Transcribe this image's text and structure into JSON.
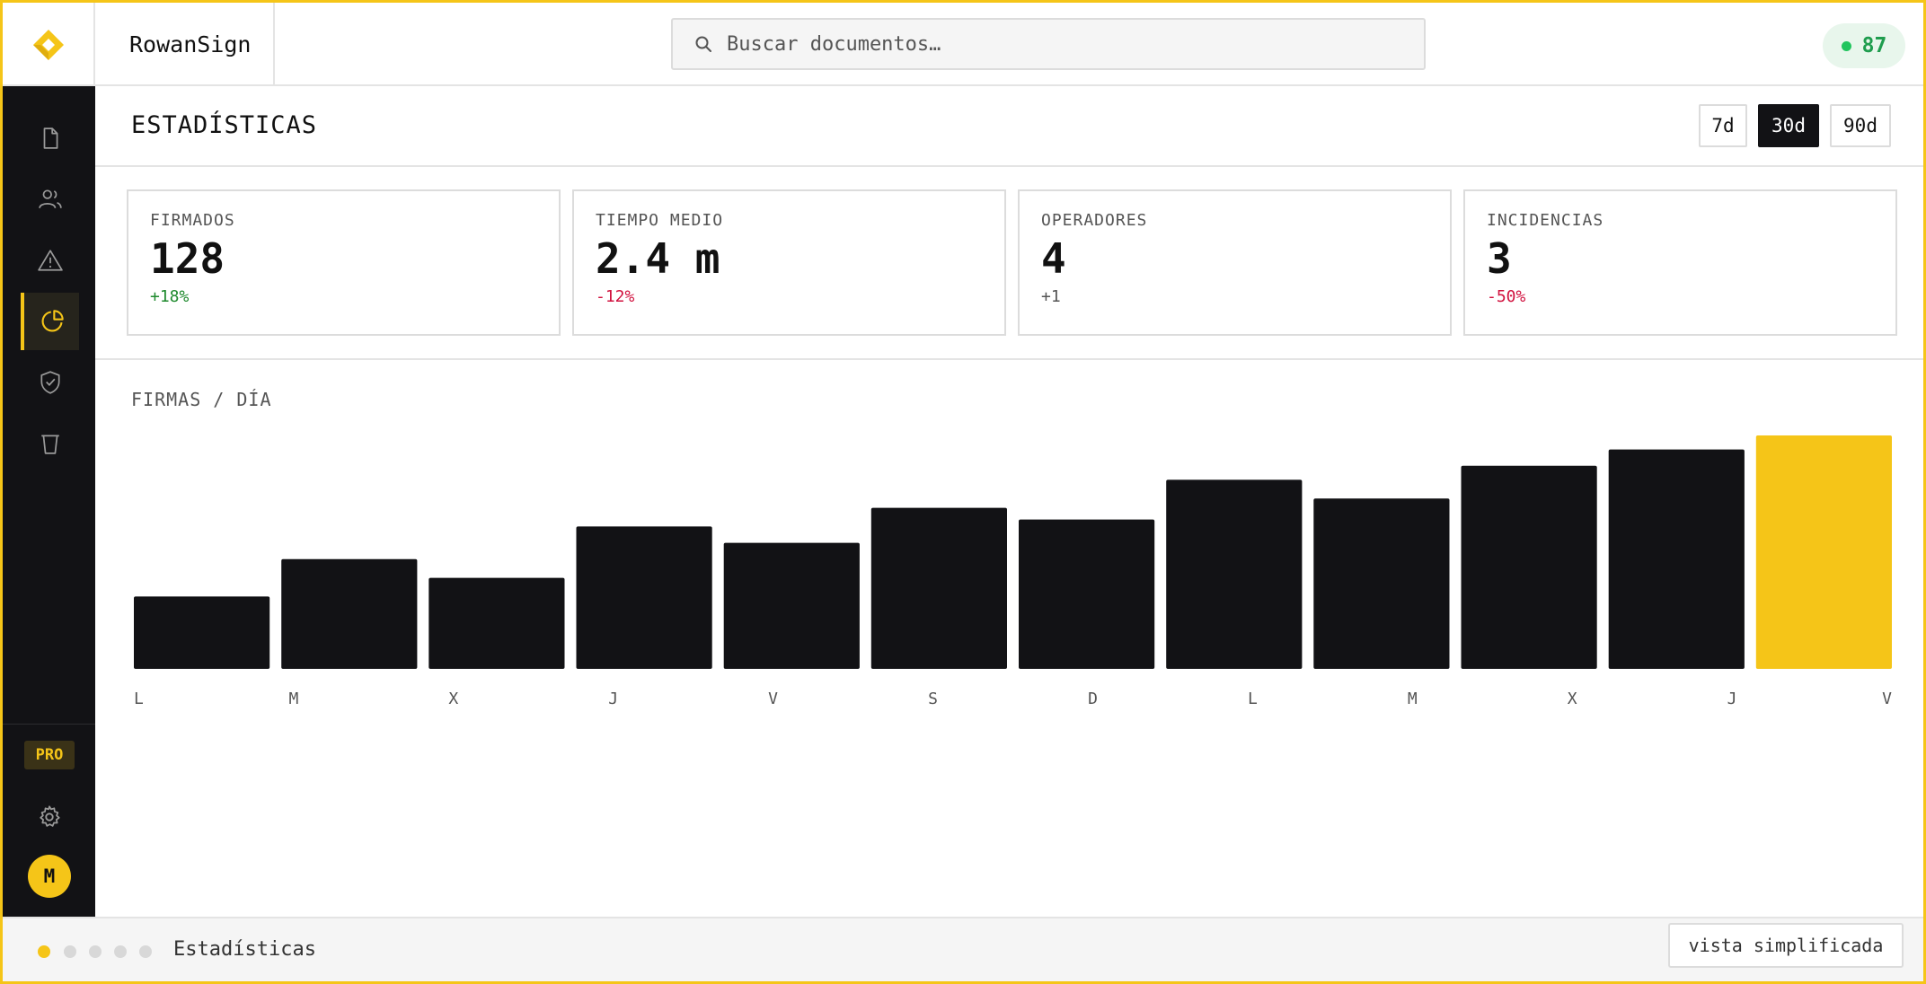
{
  "app": {
    "name": "RowanSign",
    "score": "87",
    "accent_color": "#f5c518",
    "dark_color": "#121215"
  },
  "search": {
    "placeholder": "Buscar documentos…"
  },
  "sidebar": {
    "items": [
      {
        "icon": "document-icon",
        "active": false
      },
      {
        "icon": "users-icon",
        "active": false
      },
      {
        "icon": "warning-icon",
        "active": false
      },
      {
        "icon": "pie-chart-icon",
        "active": true
      },
      {
        "icon": "shield-check-icon",
        "active": false
      },
      {
        "icon": "trash-icon",
        "active": false
      }
    ],
    "badge": "PRO",
    "settings_icon": "gear-icon",
    "avatar_initial": "M"
  },
  "page": {
    "title": "ESTADÍSTICAS",
    "ranges": [
      {
        "label": "7d",
        "active": false
      },
      {
        "label": "30d",
        "active": true
      },
      {
        "label": "90d",
        "active": false
      }
    ]
  },
  "kpis": [
    {
      "label": "FIRMADOS",
      "value": "128",
      "delta": "+18%",
      "delta_color": "#1f8a2e"
    },
    {
      "label": "TIEMPO MEDIO",
      "value": "2.4 m",
      "delta": "-12%",
      "delta_color": "#d1123f"
    },
    {
      "label": "OPERADORES",
      "value": "4",
      "delta": "+1",
      "delta_color": "#555555"
    },
    {
      "label": "INCIDENCIAS",
      "value": "3",
      "delta": "-50%",
      "delta_color": "#d1123f"
    }
  ],
  "chart_data": {
    "type": "bar",
    "title": "FIRMAS / DÍA",
    "categories": [
      "L",
      "M",
      "X",
      "J",
      "V",
      "S",
      "D",
      "L",
      "M",
      "X",
      "J",
      "V"
    ],
    "values": [
      31,
      47,
      39,
      61,
      54,
      69,
      64,
      81,
      73,
      87,
      94,
      100
    ],
    "ylim": [
      0,
      100
    ],
    "highlight_index": 11,
    "bar_color": "#121215",
    "highlight_color": "#f5c518"
  },
  "footer": {
    "steps": 5,
    "active_step": 0,
    "label": "Estadísticas",
    "simple_view_label": "vista simplificada"
  }
}
